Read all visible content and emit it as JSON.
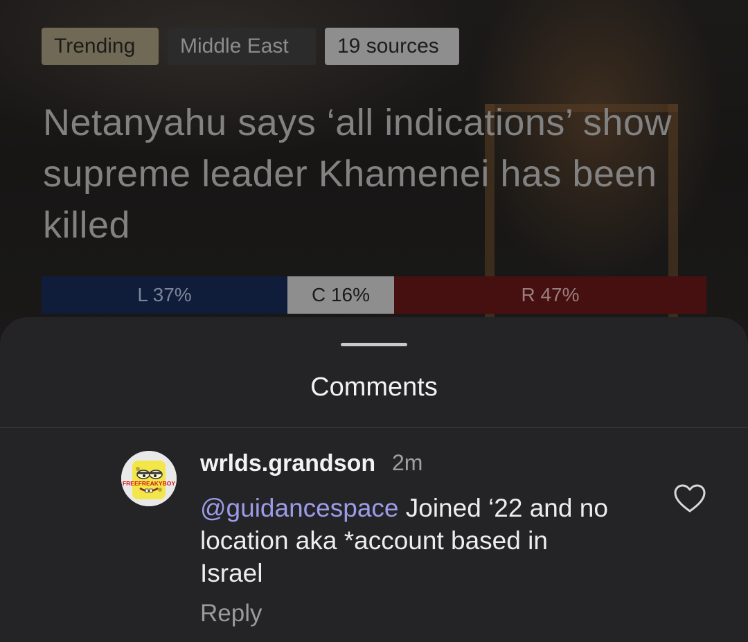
{
  "story": {
    "tags": [
      "Trending",
      "Middle East",
      "19 sources"
    ],
    "headline": "Netanyahu says ‘all indications’ show supreme leader Khamenei has been killed",
    "bias": {
      "left_label": "L 37%",
      "center_label": "C 16%",
      "right_label": "R 47%",
      "left_share": 0.37,
      "center_share": 0.16,
      "right_share": 0.47
    }
  },
  "comments_sheet": {
    "title": "Comments",
    "comments": [
      {
        "author": "wrlds.grandson",
        "time": "2m",
        "mention": "@guidancespace",
        "text": " Joined ‘22 and no location aka *account based in Israel",
        "reply_label": "Reply",
        "avatar_caption": "FREEFREAKYBOY"
      }
    ]
  },
  "colors": {
    "left": "#0f1c3a",
    "center": "#8e8e8e",
    "right": "#461010",
    "sheet": "#242426",
    "mention": "#9b9be8"
  },
  "icons": {
    "like": "heart-icon"
  }
}
